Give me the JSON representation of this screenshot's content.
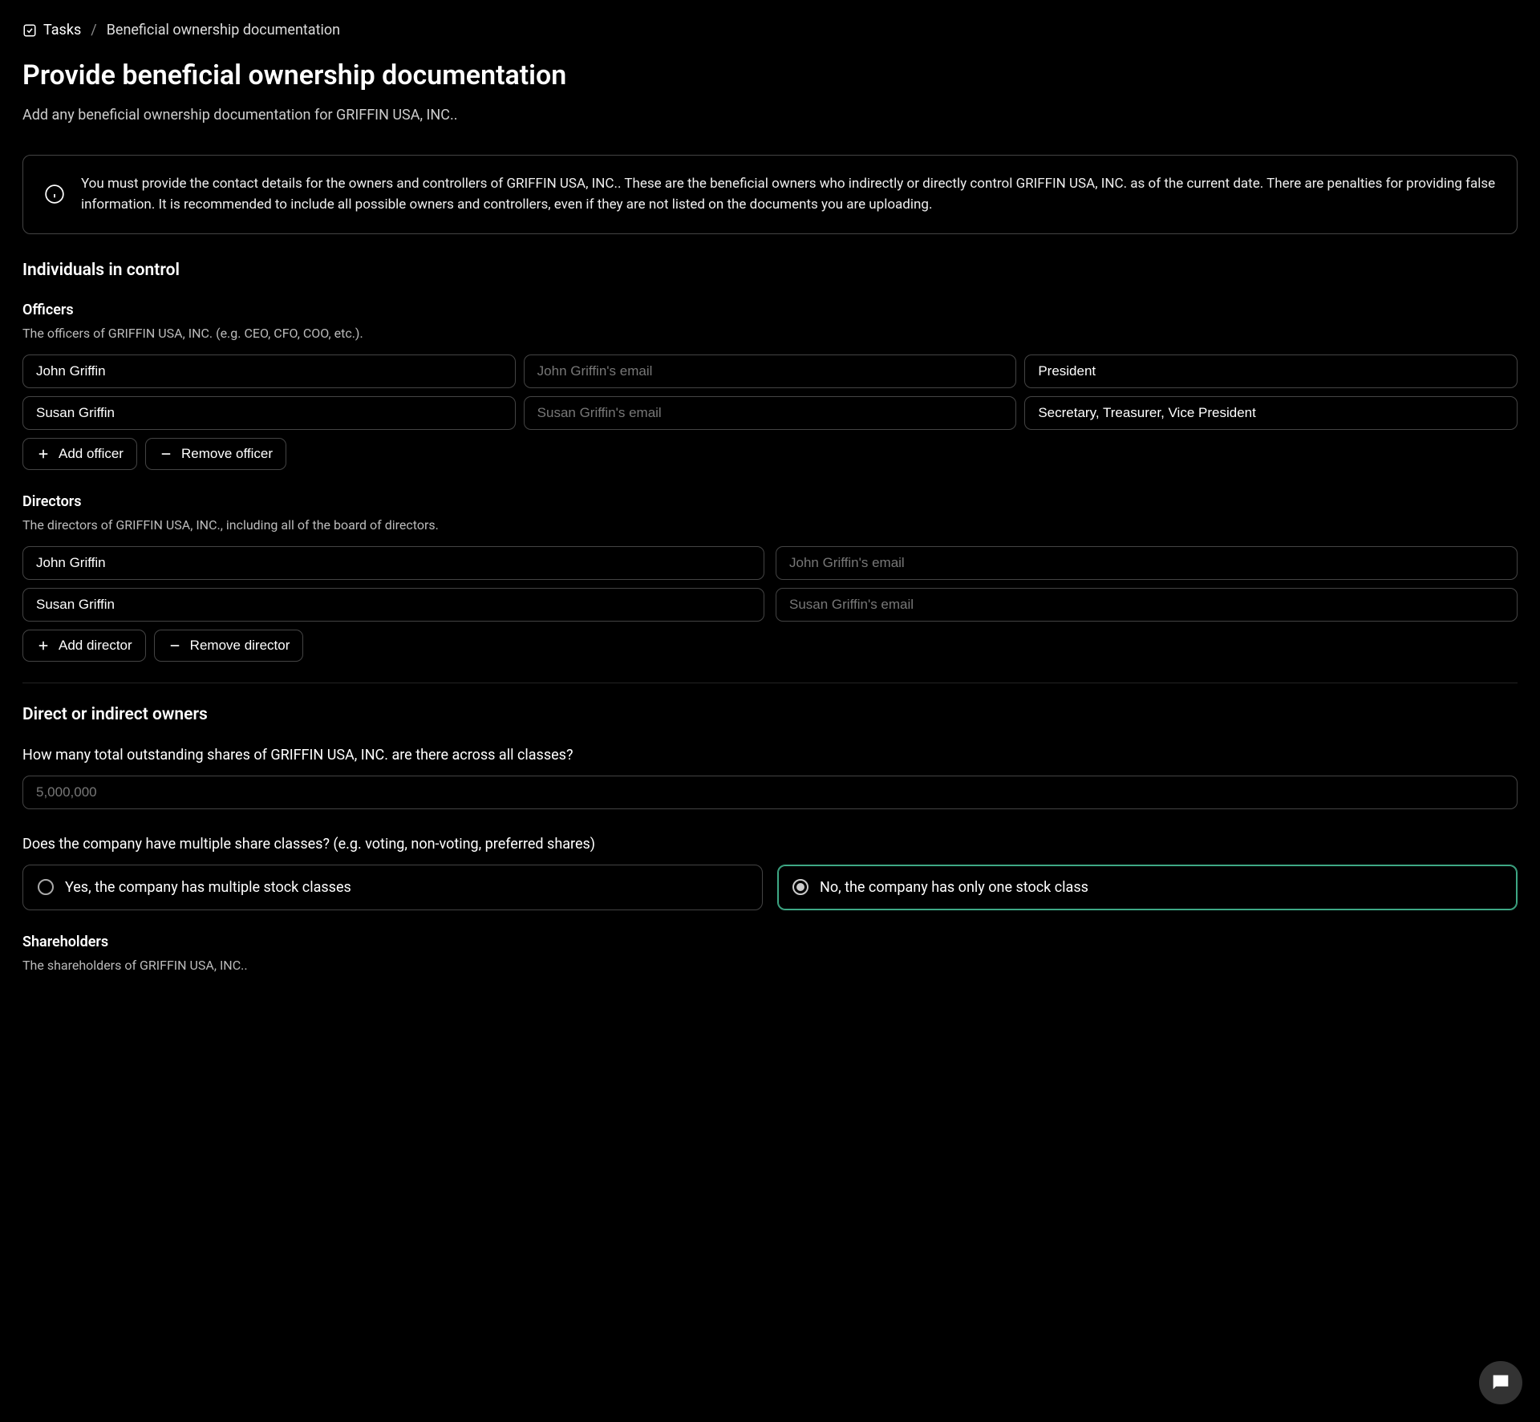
{
  "breadcrumb": {
    "root": "Tasks",
    "current": "Beneficial ownership documentation"
  },
  "page": {
    "title": "Provide beneficial ownership documentation",
    "subtitle": "Add any beneficial ownership documentation for GRIFFIN USA, INC.."
  },
  "banner": {
    "text": "You must provide the contact details for the owners and controllers of GRIFFIN USA, INC.. These are the beneficial owners who indirectly or directly control GRIFFIN USA, INC. as of the current date. There are penalties for providing false information. It is recommended to include all possible owners and controllers, even if they are not listed on the documents you are uploading."
  },
  "sections": {
    "individuals_heading": "Individuals in control",
    "officers": {
      "heading": "Officers",
      "sub": "The officers of GRIFFIN USA, INC. (e.g. CEO, CFO, COO, etc.).",
      "rows": [
        {
          "name": "John Griffin",
          "email_placeholder": "John Griffin's email",
          "title": "President"
        },
        {
          "name": "Susan Griffin",
          "email_placeholder": "Susan Griffin's email",
          "title": "Secretary, Treasurer, Vice President"
        }
      ],
      "add_label": "Add officer",
      "remove_label": "Remove officer"
    },
    "directors": {
      "heading": "Directors",
      "sub": "The directors of GRIFFIN USA, INC., including all of the board of directors.",
      "rows": [
        {
          "name": "John Griffin",
          "email_placeholder": "John Griffin's email"
        },
        {
          "name": "Susan Griffin",
          "email_placeholder": "Susan Griffin's email"
        }
      ],
      "add_label": "Add director",
      "remove_label": "Remove director"
    },
    "owners_heading": "Direct or indirect owners",
    "shares_question": "How many total outstanding shares of GRIFFIN USA, INC. are there across all classes?",
    "shares_placeholder": "5,000,000",
    "classes_question": "Does the company have multiple share classes? (e.g. voting, non-voting, preferred shares)",
    "classes_options": {
      "yes": "Yes, the company has multiple stock classes",
      "no": "No, the company has only one stock class"
    },
    "classes_selected": "no",
    "shareholders": {
      "heading": "Shareholders",
      "sub": "The shareholders of GRIFFIN USA, INC.."
    }
  }
}
